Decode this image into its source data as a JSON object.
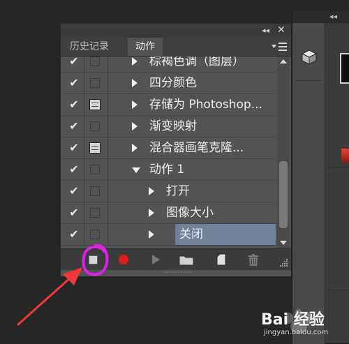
{
  "panel": {
    "tabs": [
      {
        "label": "历史记录",
        "active": false
      },
      {
        "label": "动作",
        "active": true
      }
    ],
    "collapse_glyph": "◂◂",
    "close_glyph": "✕",
    "menu_icon": "panel-menu-icon"
  },
  "actions": [
    {
      "name": "棕褐色调（图层）",
      "checked": true,
      "dialog": "off",
      "indent": 0,
      "expander": "collapsed",
      "selected": false
    },
    {
      "name": "四分颜色",
      "checked": true,
      "dialog": "off",
      "indent": 0,
      "expander": "collapsed",
      "selected": false
    },
    {
      "name": "存储为 Photoshop...",
      "checked": true,
      "dialog": "on",
      "indent": 0,
      "expander": "collapsed",
      "selected": false
    },
    {
      "name": "渐变映射",
      "checked": true,
      "dialog": "off",
      "indent": 0,
      "expander": "collapsed",
      "selected": false
    },
    {
      "name": "混合器画笔克隆...",
      "checked": true,
      "dialog": "on",
      "indent": 0,
      "expander": "collapsed",
      "selected": false
    },
    {
      "name": "动作 1",
      "checked": true,
      "dialog": "off",
      "indent": 0,
      "expander": "expanded",
      "selected": false
    },
    {
      "name": "打开",
      "checked": true,
      "dialog": "off",
      "indent": 1,
      "expander": "collapsed",
      "selected": false
    },
    {
      "name": "图像大小",
      "checked": true,
      "dialog": "off",
      "indent": 1,
      "expander": "collapsed",
      "selected": false
    },
    {
      "name": "关闭",
      "checked": true,
      "dialog": "off",
      "indent": 1,
      "expander": "collapsed",
      "selected": true
    }
  ],
  "check_glyph": "✔",
  "footer_buttons": [
    "stop-recording-button",
    "begin-recording-button",
    "play-selection-button",
    "create-new-set-button",
    "create-new-action-button",
    "delete-button"
  ],
  "colors": {
    "panel_bg": "#535353",
    "selected_row": "#71819a",
    "record_red": "#e01c1c",
    "annotation_magenta": "#e020e8",
    "annotation_arrow": "#f03a3a"
  },
  "right_dock": {
    "collapse_glyph": "◂◂",
    "icon": "3d-cube-icon"
  },
  "watermark": {
    "brand": "Bai 经验",
    "url": "jingyan.baidu.com"
  }
}
